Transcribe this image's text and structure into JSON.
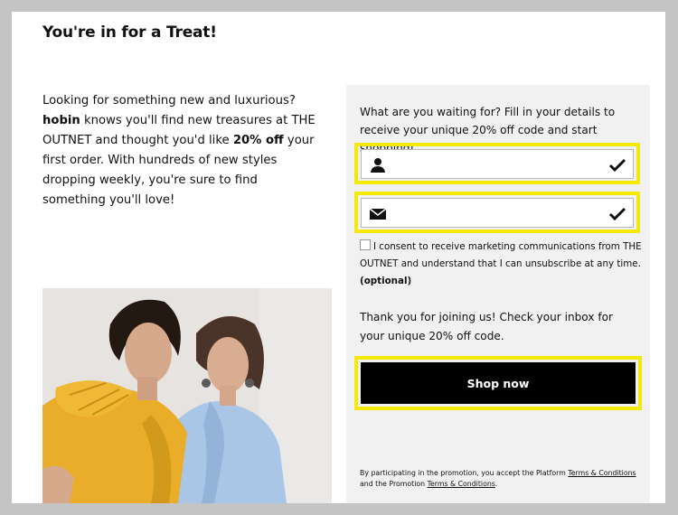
{
  "header": {
    "title": "You're in for a Treat!"
  },
  "intro": {
    "part1": "Looking for something new and luxurious? ",
    "name": "hobin",
    "part2": " knows you'll find new treasures at THE OUTNET and thought you'd like ",
    "discount": "20% off",
    "part3": " your first order. With hundreds of new styles dropping weekly, you're sure to find something you'll love!"
  },
  "form": {
    "lead": "What are you waiting for? Fill in your details to receive your unique 20% off code and start shopping!",
    "name_field": {
      "icon": "user-icon",
      "value": "",
      "status_icon": "checkmark-icon"
    },
    "email_field": {
      "icon": "envelope-icon",
      "value": "",
      "status_icon": "checkmark-icon"
    },
    "consent_text": "I consent to receive marketing communications from THE OUTNET and understand that I can unsubscribe at any time.",
    "consent_optional": "(optional)",
    "thanks": "Thank you for joining us! Check your inbox for your unique 20% off code.",
    "shop_button": "Shop now",
    "legal_part1": "By participating in the promotion, you accept the Platform ",
    "terms_link_1": "Terms & Conditions",
    "legal_part2": " and the Promotion ",
    "terms_link_2": "Terms & Conditions",
    "legal_end": "."
  },
  "colors": {
    "highlight": "#f4ea0a",
    "button": "#000000",
    "panel": "#f1f1f1",
    "backdrop": "#c4c4c4"
  }
}
